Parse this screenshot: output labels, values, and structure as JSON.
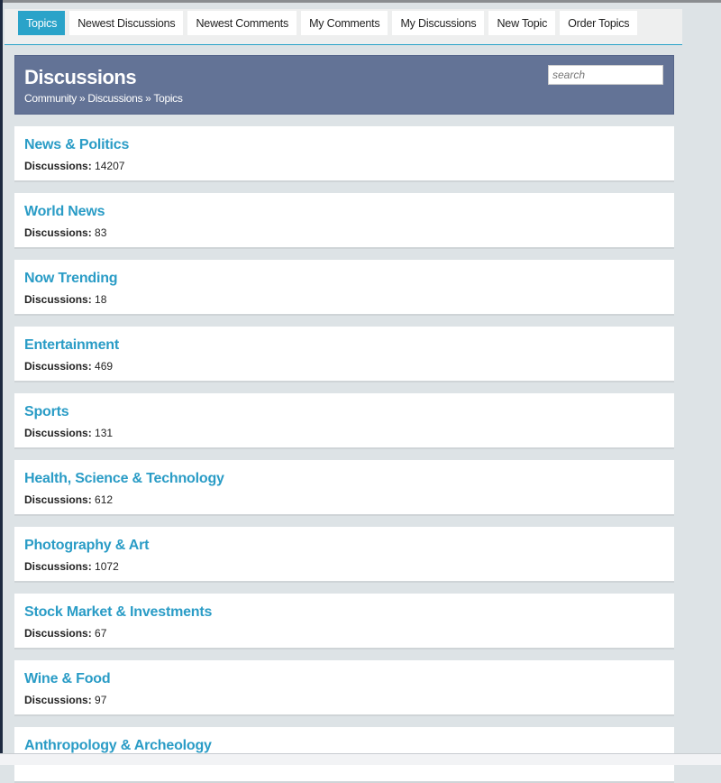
{
  "tabs": [
    {
      "label": "Topics",
      "active": true
    },
    {
      "label": "Newest Discussions"
    },
    {
      "label": "Newest Comments"
    },
    {
      "label": "My Comments"
    },
    {
      "label": "My Discussions"
    },
    {
      "label": "New Topic"
    },
    {
      "label": "Order Topics"
    }
  ],
  "header": {
    "title": "Discussions",
    "breadcrumb": "Community » Discussions » Topics",
    "search_placeholder": "search"
  },
  "discussions_label": "Discussions:",
  "topics": [
    {
      "name": "News & Politics",
      "count": "14207"
    },
    {
      "name": "World News",
      "count": "83"
    },
    {
      "name": "Now Trending",
      "count": "18"
    },
    {
      "name": "Entertainment",
      "count": "469"
    },
    {
      "name": "Sports",
      "count": "131"
    },
    {
      "name": "Health, Science & Technology",
      "count": "612"
    },
    {
      "name": "Photography & Art",
      "count": "1072"
    },
    {
      "name": "Stock Market & Investments",
      "count": "67"
    },
    {
      "name": "Wine & Food",
      "count": "97"
    },
    {
      "name": "Anthropology & Archeology",
      "count": ""
    }
  ],
  "colors": {
    "accent": "#2aa3c9",
    "header": "#637396"
  }
}
